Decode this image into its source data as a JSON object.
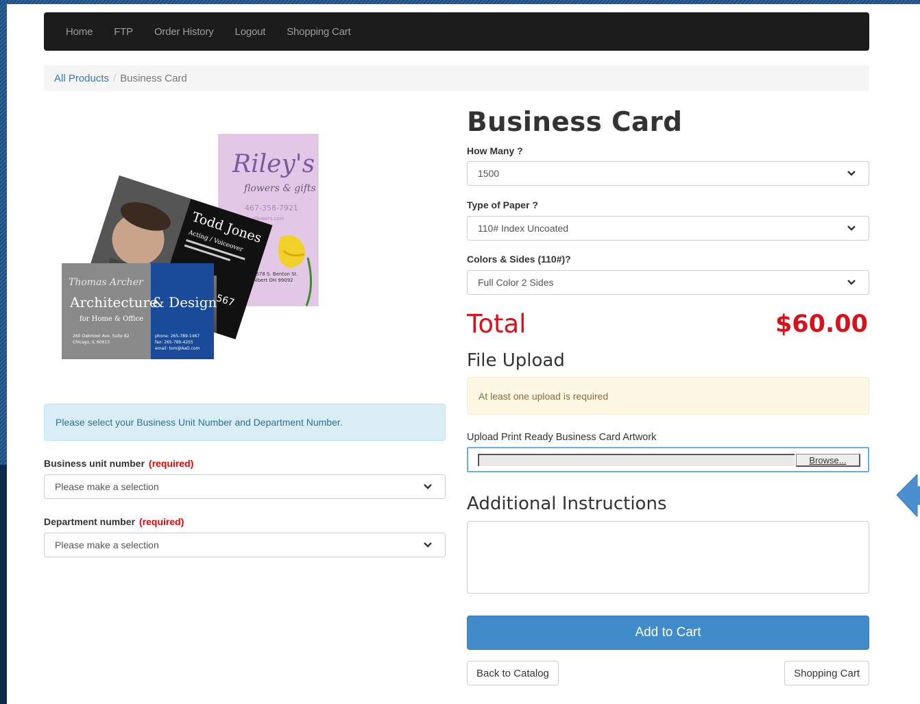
{
  "nav": {
    "items": [
      "Home",
      "FTP",
      "Order History",
      "Logout",
      "Shopping Cart"
    ]
  },
  "breadcrumb": {
    "link": "All Products",
    "separator": "/",
    "current": "Business Card"
  },
  "product": {
    "title": "Business Card",
    "image_cards": {
      "rileys": {
        "name": "Riley's",
        "tagline": "flowers & gifts",
        "phone": "467-358-7921",
        "site": "rflowers.com",
        "address1": "3578 S. Benton St.",
        "address2": "Albert OH 99092"
      },
      "todd": {
        "name": "Todd Jones",
        "title": "Acting / Voiceover",
        "number": "567"
      },
      "thomas": {
        "script": "Thomas Archer",
        "name_a": "Architecture",
        "name_b": "& Design",
        "sub": "for Home & Office",
        "addr": "260 Oakmoor Ave. Suite 82",
        "city": "Chicago, IL 60613",
        "phone": "phone: 265-789-1467",
        "fax": "fax: 265-789-4255",
        "email": "email: tom@AaD.com"
      }
    }
  },
  "info_alert": "Please select your Business Unit Number and Department Number.",
  "business_unit": {
    "label": "Business unit number",
    "required": "(required)",
    "value": "Please make a selection"
  },
  "department": {
    "label": "Department number",
    "required": "(required)",
    "value": "Please make a selection"
  },
  "options": {
    "quantity": {
      "label": "How Many ?",
      "value": "1500"
    },
    "paper": {
      "label": "Type of Paper ?",
      "value": "110# Index Uncoated"
    },
    "colors": {
      "label": "Colors & Sides (110#)?",
      "value": "Full Color 2 Sides"
    }
  },
  "total": {
    "label": "Total",
    "value": "$60.00"
  },
  "file_upload": {
    "heading": "File Upload",
    "warning": "At least one upload is required",
    "field_label": "Upload Print Ready Business Card Artwork",
    "browse_label": "Browse..."
  },
  "instructions": {
    "heading": "Additional Instructions"
  },
  "buttons": {
    "add_to_cart": "Add to Cart",
    "back": "Back to Catalog",
    "cart": "Shopping Cart"
  },
  "colors": {
    "accent": "#428bca",
    "price_red": "#d9111a",
    "required_red": "#e00000",
    "arrow_blue": "#4a90d0"
  }
}
